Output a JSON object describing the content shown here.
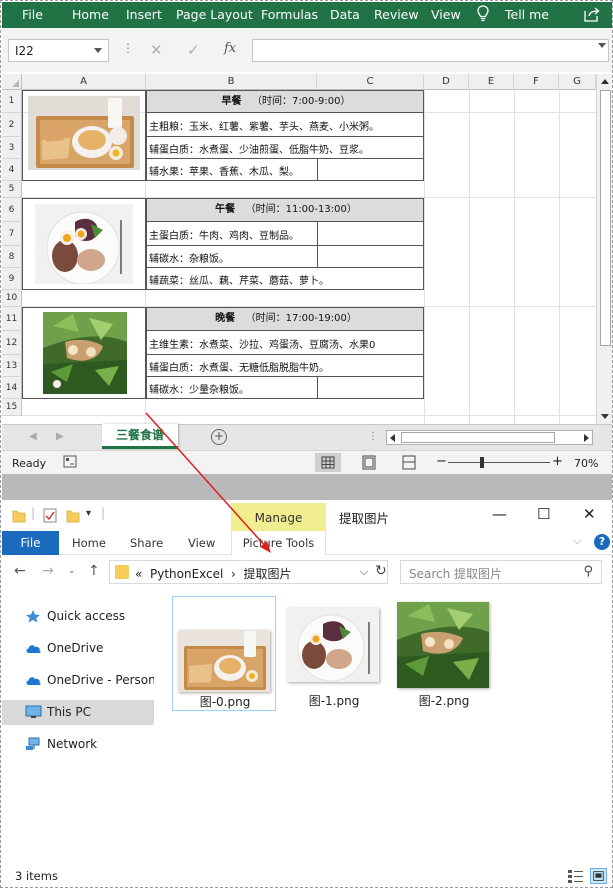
{
  "excel": {
    "tabs": [
      "File",
      "Home",
      "Insert",
      "Page Layout",
      "Formulas",
      "Data",
      "Review",
      "View"
    ],
    "tell_me": "Tell me",
    "name_box": "I22",
    "fx_label": "fx",
    "columns": [
      "A",
      "B",
      "C",
      "D",
      "E",
      "F",
      "G"
    ],
    "rows": [
      "1",
      "2",
      "3",
      "4",
      "5",
      "6",
      "7",
      "8",
      "9",
      "10",
      "11",
      "12",
      "13",
      "14",
      "15"
    ],
    "breakfast": {
      "title": "早餐",
      "time": "（时间：7:00-9:00）",
      "lines": [
        "主粗粮：玉米、红薯、紫薯、芋头、燕麦、小米粥。",
        "辅蛋白质：水煮蛋、少油煎蛋、低脂牛奶、豆浆。",
        "辅水果：苹果、香蕉、木瓜、梨。"
      ]
    },
    "lunch": {
      "title": "午餐",
      "time": "（时间：11:00-13:00）",
      "lines": [
        "主蛋白质：牛肉、鸡肉、豆制品。",
        "辅碳水：杂粮饭。",
        "辅蔬菜：丝瓜、藕、芹菜、蘑菇、萝卜。"
      ]
    },
    "dinner": {
      "title": "晚餐",
      "time": "（时间：17:00-19:00）",
      "lines": [
        "主维生素：水煮菜、沙拉、鸡蛋汤、豆腐汤、水果0",
        "辅蛋白质：水煮蛋、无糖低脂脱脂牛奶。",
        "辅碳水：少量杂粮饭。"
      ]
    },
    "sheet_tab": "三餐食谱",
    "status_ready": "Ready",
    "zoom": "70%",
    "colors": {
      "accent": "#217346"
    }
  },
  "explorer": {
    "manage": "Manage",
    "window_title": "提取图片",
    "tabs": {
      "file": "File",
      "home": "Home",
      "share": "Share",
      "view": "View",
      "picture_tools": "Picture Tools"
    },
    "breadcrumb": {
      "prefix": "«",
      "parent": "PythonExcel",
      "sep": "›",
      "current": "提取图片"
    },
    "search_placeholder": "Search 提取图片",
    "nav": [
      "Quick access",
      "OneDrive",
      "OneDrive - Personal",
      "This PC",
      "Network"
    ],
    "files": [
      "图-0.png",
      "图-1.png",
      "图-2.png"
    ],
    "item_count": "3 items",
    "colors": {
      "file_tab": "#1a6bbd",
      "manage": "#f0ee8e"
    }
  }
}
